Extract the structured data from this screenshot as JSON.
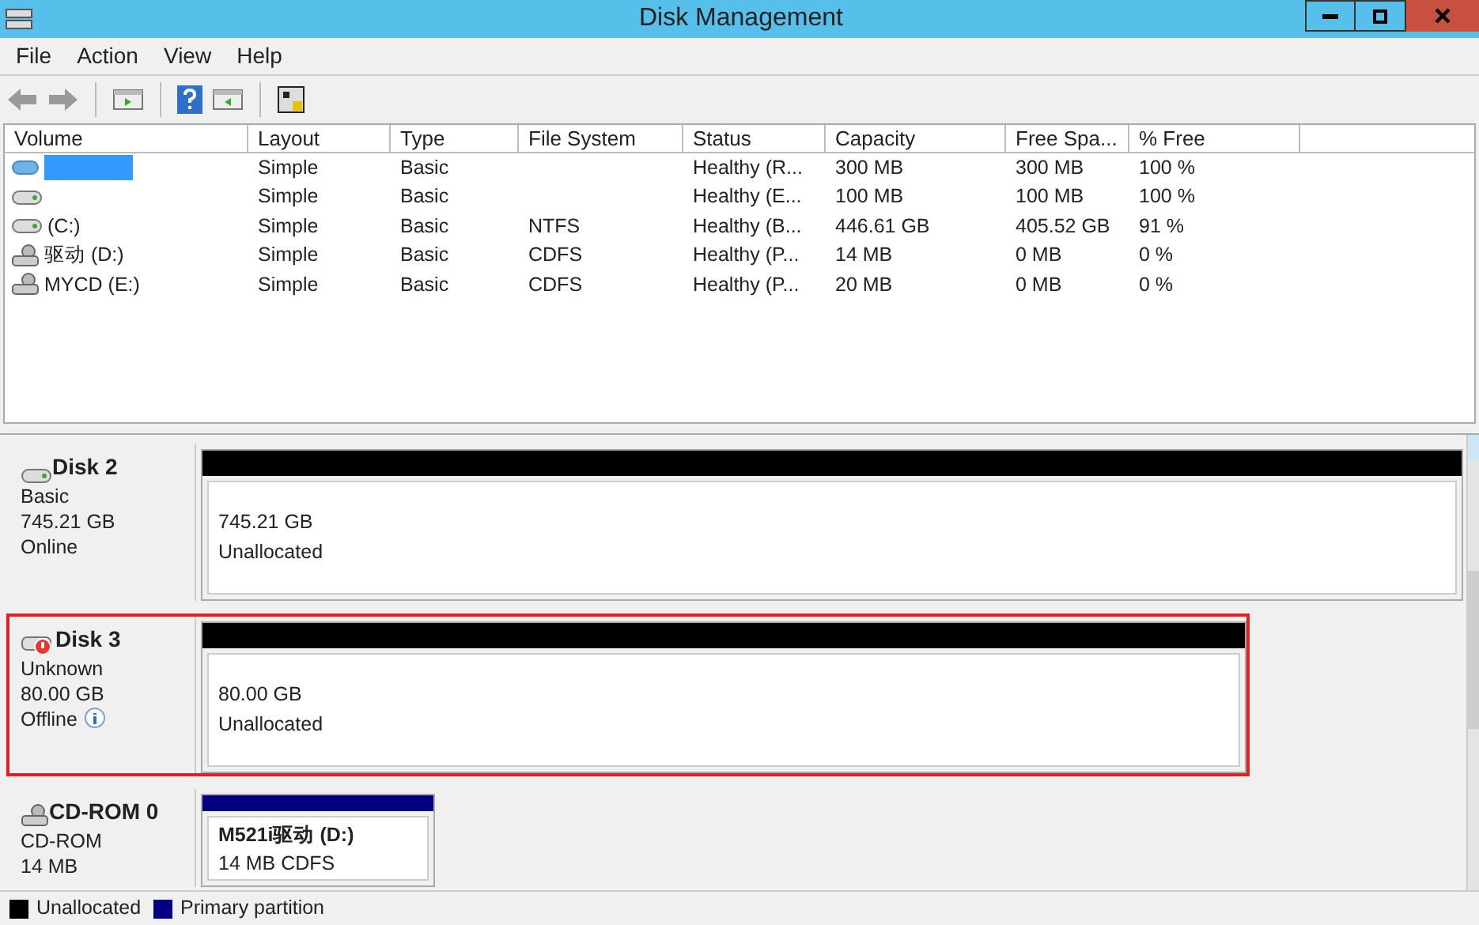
{
  "window": {
    "title": "Disk Management"
  },
  "menu": [
    "File",
    "Action",
    "View",
    "Help"
  ],
  "volumes": {
    "columns": [
      "Volume",
      "Layout",
      "Type",
      "File System",
      "Status",
      "Capacity",
      "Free Spa...",
      "% Free"
    ],
    "rows": [
      {
        "kind": "hidden",
        "cells": [
          "",
          "Simple",
          "Basic",
          "",
          "Healthy (R...",
          "300 MB",
          "300 MB",
          "100 %"
        ]
      },
      {
        "kind": "disk",
        "cells": [
          "",
          "Simple",
          "Basic",
          "",
          "Healthy (E...",
          "100 MB",
          "100 MB",
          "100 %"
        ]
      },
      {
        "kind": "disk",
        "cells": [
          "(C:)",
          "Simple",
          "Basic",
          "NTFS",
          "Healthy (B...",
          "446.61 GB",
          "405.52 GB",
          "91 %"
        ]
      },
      {
        "kind": "cd",
        "cells": [
          "驱动 (D:)",
          "Simple",
          "Basic",
          "CDFS",
          "Healthy (P...",
          "14 MB",
          "0 MB",
          "0 %"
        ]
      },
      {
        "kind": "cd",
        "cells": [
          "MYCD (E:)",
          "Simple",
          "Basic",
          "CDFS",
          "Healthy (P...",
          "20 MB",
          "0 MB",
          "0 %"
        ]
      }
    ]
  },
  "disks": [
    {
      "kind": "disk",
      "name": "Disk 2",
      "lines": [
        "Basic",
        "745.21 GB",
        "Online"
      ],
      "info_icon": false,
      "highlighted": false,
      "partitions": [
        {
          "kind": "unallocated",
          "lines": [
            "745.21 GB",
            "Unallocated"
          ]
        }
      ]
    },
    {
      "kind": "offline",
      "name": "Disk 3",
      "lines": [
        "Unknown",
        "80.00 GB",
        "Offline"
      ],
      "info_icon": true,
      "highlighted": true,
      "partitions": [
        {
          "kind": "unallocated",
          "lines": [
            "80.00 GB",
            "Unallocated"
          ]
        }
      ]
    },
    {
      "kind": "cdrom",
      "name": "CD-ROM 0",
      "lines": [
        "CD-ROM",
        "14 MB"
      ],
      "info_icon": false,
      "highlighted": false,
      "partitions": [
        {
          "kind": "primary",
          "title": "M521i驱动 (D:)",
          "lines": [
            "14 MB CDFS"
          ]
        }
      ]
    }
  ],
  "legend": [
    {
      "label": "Unallocated",
      "color": "#000000"
    },
    {
      "label": "Primary partition",
      "color": "#000080"
    }
  ]
}
